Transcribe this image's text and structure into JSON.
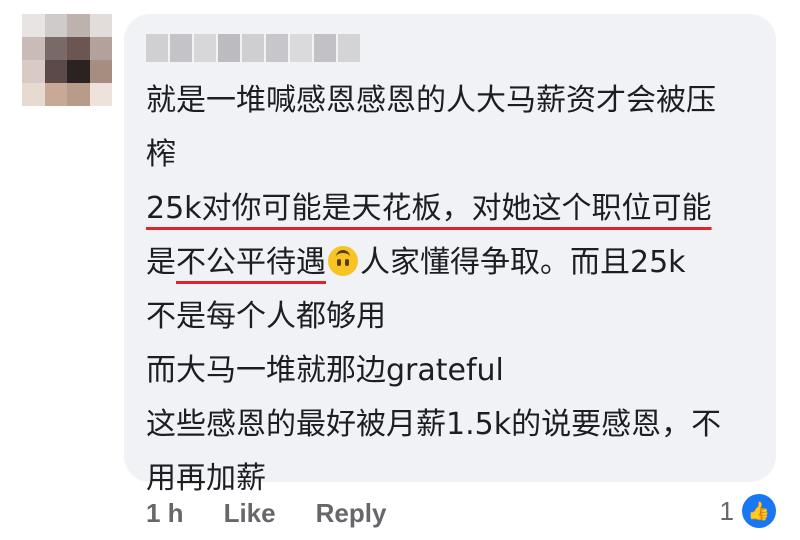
{
  "comment": {
    "author_name": "",
    "lines": [
      "就是一堆喊感恩感恩的人大马薪资才会被压",
      "榨",
      "25k对你可能是天花板，对她这个职位可能",
      "是",
      "不公平待遇",
      "人家懂得争取。而且25k",
      "不是每个人都够用",
      "而大马一堆就那边grateful",
      "这些感恩的最好被月薪1.5k的说要感恩，不",
      "用再加薪"
    ],
    "emoji_icon": "upside-down-face-emoji",
    "underline_color": "#e0242a"
  },
  "actions": {
    "timestamp": "1 h",
    "like_label": "Like",
    "reply_label": "Reply"
  },
  "reactions": {
    "count": "1",
    "icon": "thumbs-up-icon",
    "color": "#1877f2"
  },
  "colors": {
    "bubble_bg": "#f0f2f5",
    "text": "#1c1e21",
    "muted": "#65676b"
  }
}
